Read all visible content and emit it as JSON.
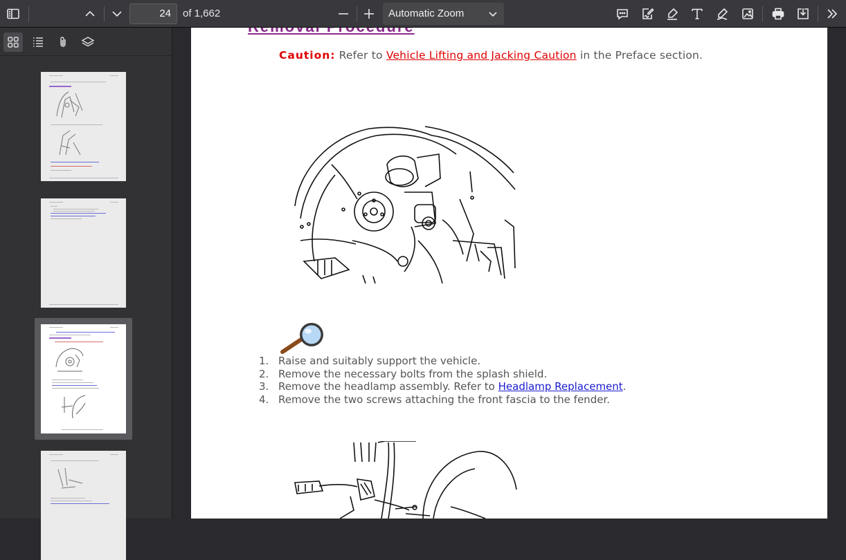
{
  "toolbar": {
    "page_number": "24",
    "page_count": "of 1,662",
    "zoom": "Automatic Zoom"
  },
  "document": {
    "section_title": "Removal Procedure",
    "caution": {
      "label": "Caution:",
      "prefix": "Refer to",
      "link": "Vehicle Lifting and Jacking Caution",
      "suffix": "in the Preface section."
    },
    "steps": [
      {
        "num": "1.",
        "text": "Raise and suitably support the vehicle.",
        "link": "",
        "after": ""
      },
      {
        "num": "2.",
        "text": "Remove the necessary bolts from the splash shield.",
        "link": "",
        "after": ""
      },
      {
        "num": "3.",
        "text": "Remove the headlamp assembly. Refer to",
        "link": "Headlamp Replacement",
        "after": "."
      },
      {
        "num": "4.",
        "text": "Remove the two screws attaching the front fascia to the fender.",
        "link": "",
        "after": ""
      }
    ]
  },
  "colors": {
    "toolbar_bg": "#38383d",
    "sidebar_bg": "#323234",
    "viewer_bg": "#2a2a2e",
    "caution_red": "#e00000",
    "link_blue": "#1a1ad0"
  },
  "icons": {
    "toolbar": [
      "sidebar-toggle-icon",
      "chevron-up-icon",
      "chevron-down-icon",
      "zoom-out-icon",
      "zoom-in-icon",
      "comment-icon",
      "signature-icon",
      "highlight-icon",
      "text-icon",
      "draw-icon",
      "image-icon",
      "print-icon",
      "save-icon",
      "more-tools-icon"
    ],
    "sidebar": [
      "thumbnails-icon",
      "outline-icon",
      "attachments-icon",
      "layers-icon"
    ]
  }
}
